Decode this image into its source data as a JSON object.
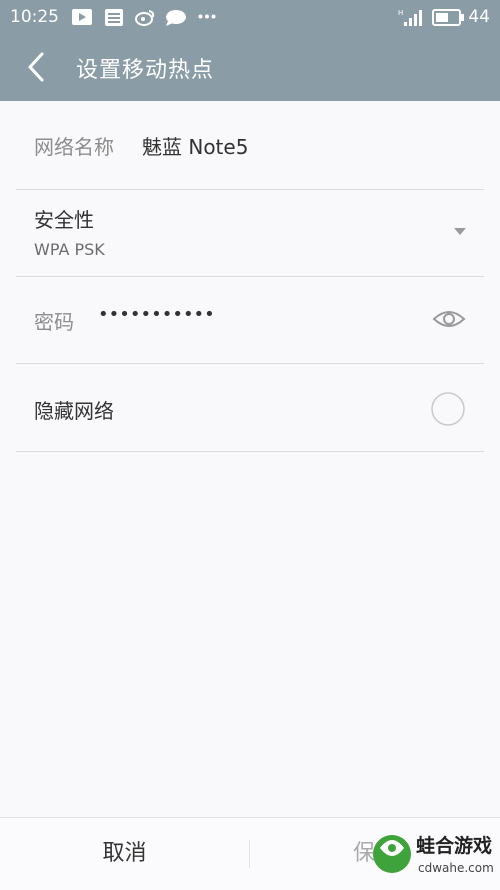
{
  "status_bar": {
    "time": "10:25",
    "battery": "44"
  },
  "header": {
    "title": "设置移动热点"
  },
  "form": {
    "network_name": {
      "label": "网络名称",
      "value": "魅蓝 Note5"
    },
    "security": {
      "label": "安全性",
      "value": "WPA PSK"
    },
    "password": {
      "label": "密码",
      "value": "•••••••••••"
    },
    "hide_network": {
      "label": "隐藏网络",
      "checked": false
    }
  },
  "footer": {
    "cancel": "取消",
    "save": "保存"
  },
  "watermark": {
    "name": "蛙合游戏",
    "url": "cdwahe.com"
  },
  "colors": {
    "header_bg": "#8a9ca6",
    "page_bg": "#f9f8fb",
    "watermark_green": "#3fa33c"
  }
}
